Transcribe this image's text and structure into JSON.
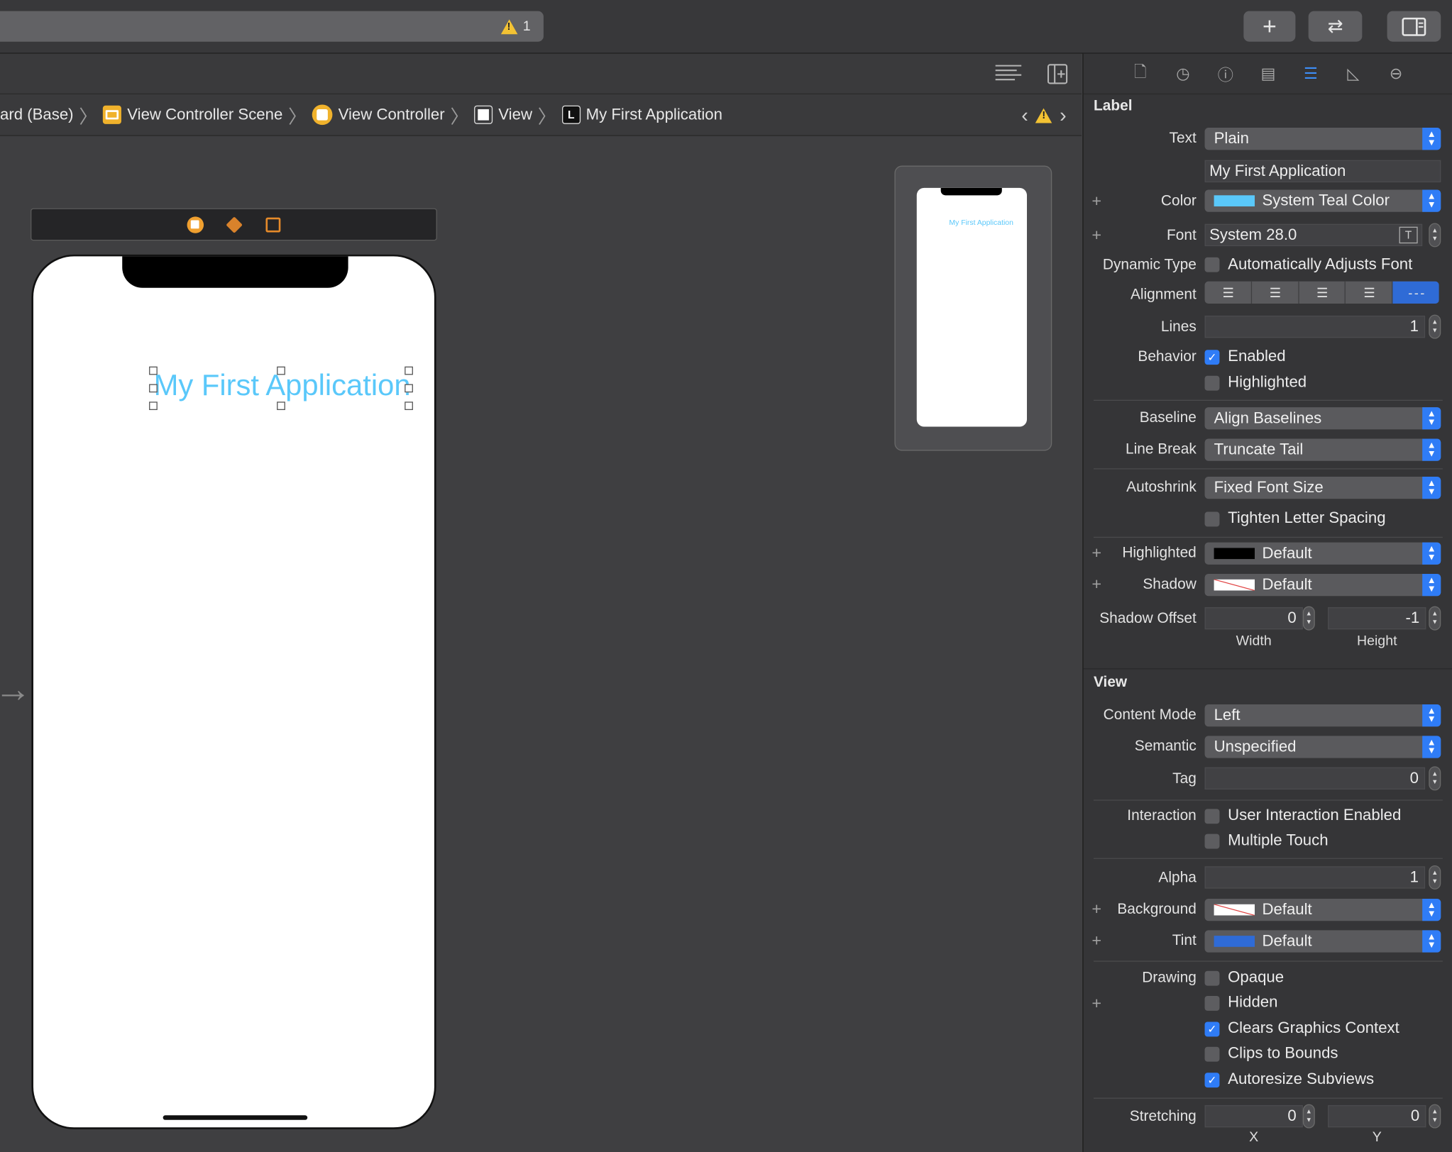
{
  "toolbar": {
    "warning_count": "1",
    "add_icon": "plus-icon",
    "swap_icon": "arrows-swap-icon",
    "inspector_toggle_icon": "sidebar-right-icon"
  },
  "breadcrumb": {
    "items": [
      {
        "label": "ard (Base)"
      },
      {
        "label": "View Controller Scene",
        "icon": "scene-icon"
      },
      {
        "label": "View Controller",
        "icon": "view-controller-icon"
      },
      {
        "label": "View",
        "icon": "view-icon"
      },
      {
        "label": "My First Application",
        "icon": "label-icon",
        "icon_text": "L"
      }
    ]
  },
  "canvas": {
    "label_text": "My First Application",
    "label_color": "#5ac8fa",
    "minimap_label": "My First Application"
  },
  "inspector": {
    "label_section": {
      "title": "Label",
      "text": {
        "label": "Text",
        "value": "Plain"
      },
      "text_content": "My First Application",
      "color": {
        "label": "Color",
        "value": "System Teal Color",
        "swatch": "#5ac8fa"
      },
      "font": {
        "label": "Font",
        "value": "System 28.0"
      },
      "dynamic_type": {
        "label": "Dynamic Type",
        "checkbox": "Automatically Adjusts Font",
        "checked": false
      },
      "alignment": {
        "label": "Alignment",
        "options": [
          "left",
          "center",
          "right",
          "justified",
          "natural"
        ],
        "selected": "natural"
      },
      "lines": {
        "label": "Lines",
        "value": "1"
      },
      "behavior": {
        "label": "Behavior",
        "enabled": "Enabled",
        "enabled_checked": true,
        "highlighted": "Highlighted",
        "highlighted_checked": false
      },
      "baseline": {
        "label": "Baseline",
        "value": "Align Baselines"
      },
      "line_break": {
        "label": "Line Break",
        "value": "Truncate Tail"
      },
      "autoshrink": {
        "label": "Autoshrink",
        "value": "Fixed Font Size"
      },
      "tighten": {
        "label": "Tighten Letter Spacing",
        "checked": false
      },
      "highlighted_color": {
        "label": "Highlighted",
        "value": "Default",
        "swatch": "#000000"
      },
      "shadow": {
        "label": "Shadow",
        "value": "Default"
      },
      "shadow_offset": {
        "label": "Shadow Offset",
        "width": "0",
        "height": "-1",
        "width_label": "Width",
        "height_label": "Height"
      }
    },
    "view_section": {
      "title": "View",
      "content_mode": {
        "label": "Content Mode",
        "value": "Left"
      },
      "semantic": {
        "label": "Semantic",
        "value": "Unspecified"
      },
      "tag": {
        "label": "Tag",
        "value": "0"
      },
      "interaction": {
        "label": "Interaction",
        "user_interaction": "User Interaction Enabled",
        "user_interaction_checked": false,
        "multiple_touch": "Multiple Touch",
        "multiple_touch_checked": false
      },
      "alpha": {
        "label": "Alpha",
        "value": "1"
      },
      "background": {
        "label": "Background",
        "value": "Default"
      },
      "tint": {
        "label": "Tint",
        "value": "Default",
        "swatch": "#2f6bd6"
      },
      "drawing": {
        "label": "Drawing",
        "options": [
          {
            "label": "Opaque",
            "checked": false
          },
          {
            "label": "Hidden",
            "checked": false
          },
          {
            "label": "Clears Graphics Context",
            "checked": true
          },
          {
            "label": "Clips to Bounds",
            "checked": false
          },
          {
            "label": "Autoresize Subviews",
            "checked": true
          }
        ]
      },
      "stretching": {
        "label": "Stretching",
        "x": "0",
        "y": "0",
        "x_label": "X",
        "y_label": "Y"
      }
    }
  },
  "colors": {
    "accent": "#2f7cf6",
    "warning": "#f3c233"
  }
}
